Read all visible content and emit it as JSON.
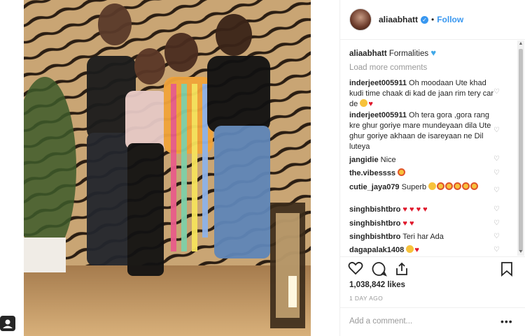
{
  "post": {
    "username": "aliaabhatt",
    "follow_label": "Follow",
    "dot": "•",
    "verified_icon": "verified-badge-icon"
  },
  "caption": {
    "username": "aliaabhatt",
    "text": "Formalities",
    "emoji": "blue-heart"
  },
  "load_more": "Load more comments",
  "comments": [
    {
      "user": "inderjeet005911",
      "text": "Oh moodaan Ute khad kudi time chaak di kad de jaan rim tery car de"
    },
    {
      "user": "inderjeet005911",
      "text": "Oh tera gora ,gora rang kre ghur goriye mare mundeyaan dila Ute ghur goriye akhaan de isareyaan ne Dil luteya"
    },
    {
      "user": "jangidie",
      "text": "Nice"
    },
    {
      "user": "the.vibessss",
      "text": ""
    },
    {
      "user": "cutie_jaya079",
      "text": "Superb"
    },
    {
      "user": "singhbishtbro",
      "text": ""
    },
    {
      "user": "singhbishtbro",
      "text": ""
    },
    {
      "user": "singhbishtbro",
      "text": "Teri har Ada"
    },
    {
      "user": "dagapalak1408",
      "text": ""
    }
  ],
  "likes": "1,038,842 likes",
  "time_ago": "1 DAY AGO",
  "add_comment_placeholder": "Add a comment...",
  "more_options": "•••",
  "colors": {
    "link_blue": "#3897f0",
    "heart_red": "#e0182b",
    "muted_gray": "#999999"
  }
}
